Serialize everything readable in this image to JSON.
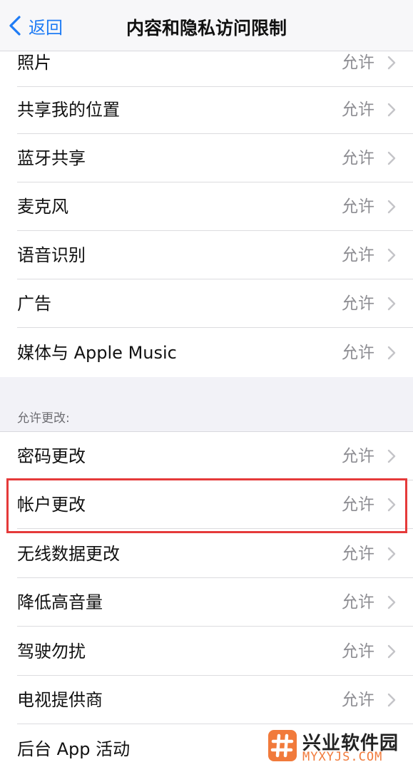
{
  "nav": {
    "back_label": "返回",
    "title": "内容和隐私访问限制"
  },
  "rows_top": [
    {
      "label": "照片",
      "value": "允许"
    },
    {
      "label": "共享我的位置",
      "value": "允许"
    },
    {
      "label": "蓝牙共享",
      "value": "允许"
    },
    {
      "label": "麦克风",
      "value": "允许"
    },
    {
      "label": "语音识别",
      "value": "允许"
    },
    {
      "label": "广告",
      "value": "允许"
    },
    {
      "label": "媒体与 Apple Music",
      "value": "允许"
    }
  ],
  "section_header": "允许更改:",
  "rows_bottom": [
    {
      "label": "密码更改",
      "value": "允许"
    },
    {
      "label": "帐户更改",
      "value": "允许"
    },
    {
      "label": "无线数据更改",
      "value": "允许"
    },
    {
      "label": "降低高音量",
      "value": "允许"
    },
    {
      "label": "驾驶勿扰",
      "value": "允许"
    },
    {
      "label": "电视提供商",
      "value": "允许"
    },
    {
      "label": "后台 App 活动",
      "value": ""
    }
  ],
  "watermark": {
    "name": "兴业软件园",
    "domain": "MYXYJS.COM"
  },
  "colors": {
    "accent": "#1f7cf5",
    "value_gray": "#8e8e93",
    "highlight": "#e53a3a",
    "watermark": "#f17a3b"
  }
}
